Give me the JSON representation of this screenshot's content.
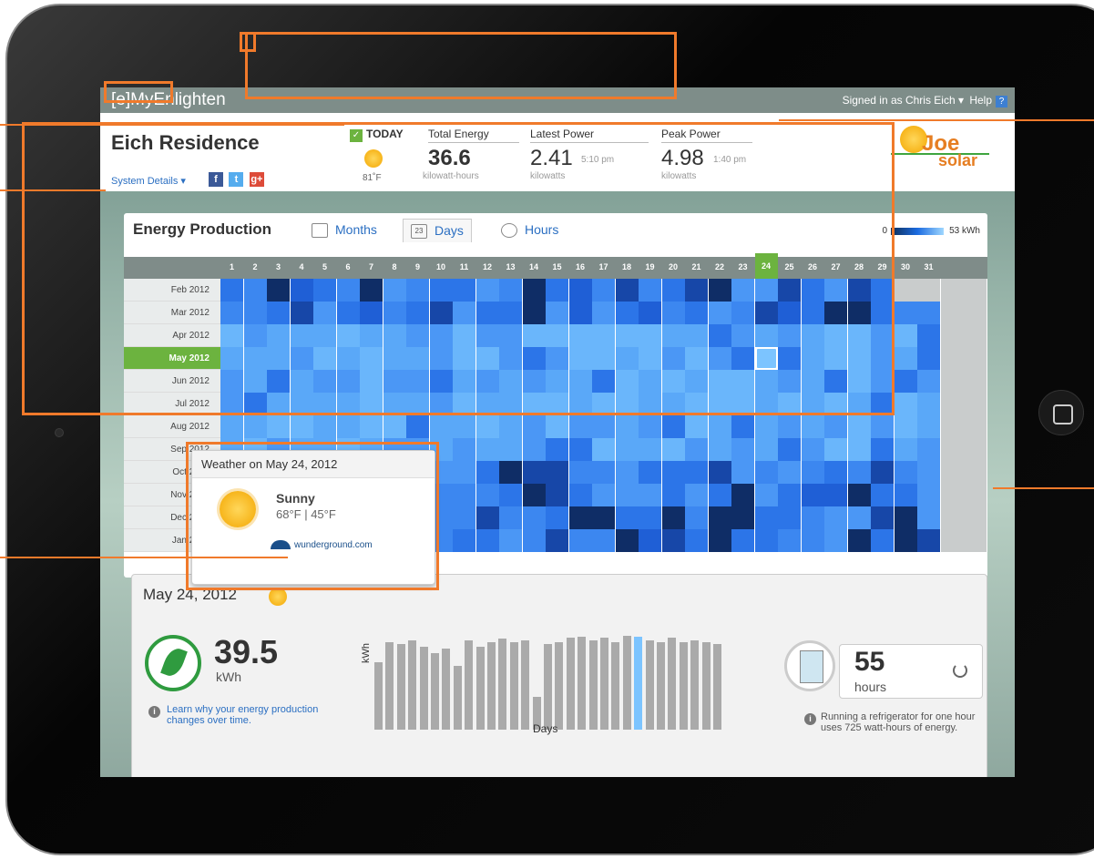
{
  "app": {
    "brand": "[e]MyEnlighten",
    "signed_in": "Signed in as Chris Eich ▾",
    "help": "Help",
    "help_icon": "?"
  },
  "site": {
    "name": "Eich Residence",
    "system_details": "System Details ▾",
    "social": [
      "f",
      "t",
      "g+"
    ]
  },
  "today": {
    "label": "TODAY",
    "temp": "81˚F",
    "total_energy": {
      "label": "Total Energy",
      "value": "36.6",
      "unit": "kilowatt-hours"
    },
    "latest_power": {
      "label": "Latest Power",
      "value": "2.41",
      "time": "5:10 pm",
      "unit": "kilowatts"
    },
    "peak_power": {
      "label": "Peak Power",
      "value": "4.98",
      "time": "1:40 pm",
      "unit": "kilowatts"
    }
  },
  "logo": {
    "joe": "Joe",
    "solar": "solar"
  },
  "panel": {
    "title": "Energy Production",
    "tabs": [
      {
        "label": "Months",
        "icon": "calendar-icon"
      },
      {
        "label": "Days",
        "icon": "calendar-23-icon",
        "icon_text": "23"
      },
      {
        "label": "Hours",
        "icon": "clock-icon"
      }
    ],
    "legend_min": "0",
    "legend_max": "53 kWh",
    "days": [
      "1",
      "2",
      "3",
      "4",
      "5",
      "6",
      "7",
      "8",
      "9",
      "10",
      "11",
      "12",
      "13",
      "14",
      "15",
      "16",
      "17",
      "18",
      "19",
      "20",
      "21",
      "22",
      "23",
      "24",
      "25",
      "26",
      "27",
      "28",
      "29",
      "30",
      "31"
    ],
    "selected_day": "24",
    "months": [
      "Feb 2012",
      "Mar 2012",
      "Apr 2012",
      "May 2012",
      "Jun 2012",
      "Jul 2012",
      "Aug 2012",
      "Sep 2012",
      "Oct 2012",
      "Nov 2012",
      "Dec 2012",
      "Jan 2013"
    ],
    "selected_month": "May 2012",
    "scroll_up": "^",
    "scroll_down": "v"
  },
  "detail": {
    "date": "May 24, 2012",
    "energy_value": "39.5",
    "energy_unit": "kWh",
    "learn_link": "Learn why your energy production changes over time.",
    "x_axis": "Days",
    "y_axis": "kWh",
    "hours_value": "55",
    "hours_unit": "hours",
    "fridge_note": "Running a refrigerator for one hour uses 725 watt-hours of energy."
  },
  "weather": {
    "title": "Weather on May 24, 2012",
    "condition": "Sunny",
    "temps": "68°F | 45°F",
    "source": "wunderground.com"
  },
  "colors": {
    "accent_orange": "#f07a2b",
    "green": "#6cb33f",
    "link_blue": "#2b6fc2"
  },
  "minibar_levels": [
    0.62,
    0.8,
    0.78,
    0.82,
    0.76,
    0.7,
    0.74,
    0.58,
    0.82,
    0.76,
    0.8,
    0.83,
    0.8,
    0.82,
    0.3,
    0.78,
    0.8,
    0.84,
    0.85,
    0.82,
    0.84,
    0.8,
    0.86,
    0.85,
    0.82,
    0.8,
    0.84,
    0.8,
    0.82,
    0.8,
    0.78
  ]
}
